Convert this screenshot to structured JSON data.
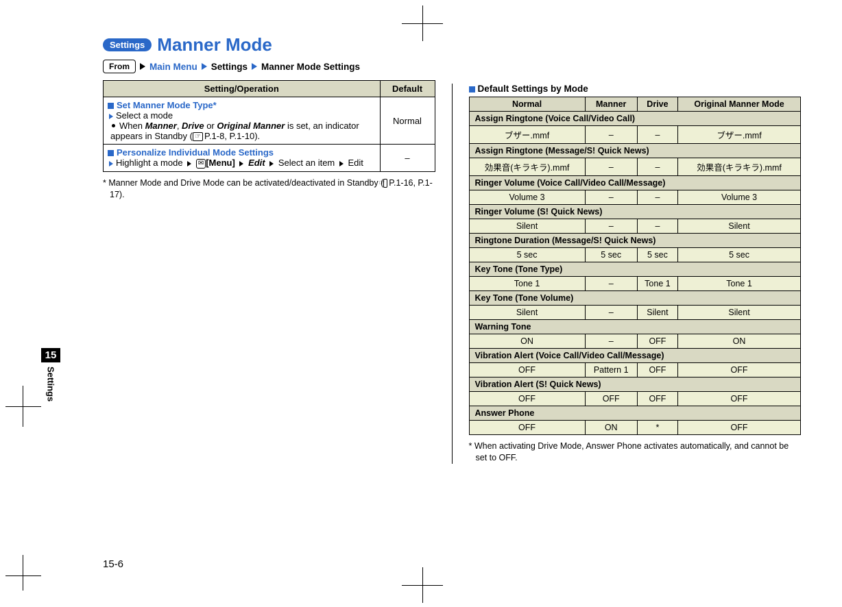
{
  "badge": "Settings",
  "title": "Manner Mode",
  "from_label": "From",
  "breadcrumb": [
    "Main Menu",
    "Settings",
    "Manner Mode Settings"
  ],
  "left_table": {
    "head": [
      "Setting/Operation",
      "Default"
    ],
    "rows": [
      {
        "title": "Set Manner Mode Type*",
        "line1": "Select a mode",
        "bullet_prefix": "When ",
        "bullet_em1": "Manner",
        "bullet_mid1": ", ",
        "bullet_em2": "Drive",
        "bullet_mid2": " or ",
        "bullet_em3": "Original Manner",
        "bullet_tail": " is set, an indicator appears in Standby (",
        "bullet_ref": "P.1-8, P.1-10",
        "bullet_close": ").",
        "default": "Normal"
      },
      {
        "title": "Personalize Individual Mode Settings",
        "line_p1": "Highlight a mode",
        "menu_lbl": "[Menu]",
        "edit_lbl": "Edit",
        "line_p2": "Select an item",
        "line_p3": "Edit",
        "default": "–"
      }
    ]
  },
  "footnote_left_a": "* Manner Mode and Drive Mode can be activated/deactivated in Standby (",
  "footnote_left_ref": "P.1-16, P.1-17",
  "footnote_left_b": ").",
  "right_heading": "Default Settings by Mode",
  "mode_headers": [
    "Normal",
    "Manner",
    "Drive",
    "Original Manner Mode"
  ],
  "groups": [
    {
      "label": "Assign Ringtone (Voice Call/Video Call)",
      "vals": [
        "ブザー.mmf",
        "–",
        "–",
        "ブザー.mmf"
      ]
    },
    {
      "label": "Assign Ringtone (Message/S! Quick News)",
      "vals": [
        "効果音(キラキラ).mmf",
        "–",
        "–",
        "効果音(キラキラ).mmf"
      ]
    },
    {
      "label": "Ringer Volume (Voice Call/Video Call/Message)",
      "vals": [
        "Volume 3",
        "–",
        "–",
        "Volume 3"
      ]
    },
    {
      "label": "Ringer Volume (S! Quick News)",
      "vals": [
        "Silent",
        "–",
        "–",
        "Silent"
      ]
    },
    {
      "label": "Ringtone Duration (Message/S! Quick News)",
      "vals": [
        "5 sec",
        "5 sec",
        "5 sec",
        "5 sec"
      ]
    },
    {
      "label": "Key Tone (Tone Type)",
      "vals": [
        "Tone 1",
        "–",
        "Tone 1",
        "Tone 1"
      ]
    },
    {
      "label": "Key Tone (Tone Volume)",
      "vals": [
        "Silent",
        "–",
        "Silent",
        "Silent"
      ]
    },
    {
      "label": "Warning Tone",
      "vals": [
        "ON",
        "–",
        "OFF",
        "ON"
      ]
    },
    {
      "label": "Vibration Alert (Voice Call/Video Call/Message)",
      "vals": [
        "OFF",
        "Pattern 1",
        "OFF",
        "OFF"
      ]
    },
    {
      "label": "Vibration Alert (S! Quick News)",
      "vals": [
        "OFF",
        "OFF",
        "OFF",
        "OFF"
      ]
    },
    {
      "label": "Answer Phone",
      "vals": [
        "OFF",
        "ON",
        "*",
        "OFF"
      ]
    }
  ],
  "footnote_right": "* When activating Drive Mode, Answer Phone activates automatically, and cannot be set to OFF.",
  "side_tab_num": "15",
  "side_tab_label": "Settings",
  "page_number": "15-6"
}
